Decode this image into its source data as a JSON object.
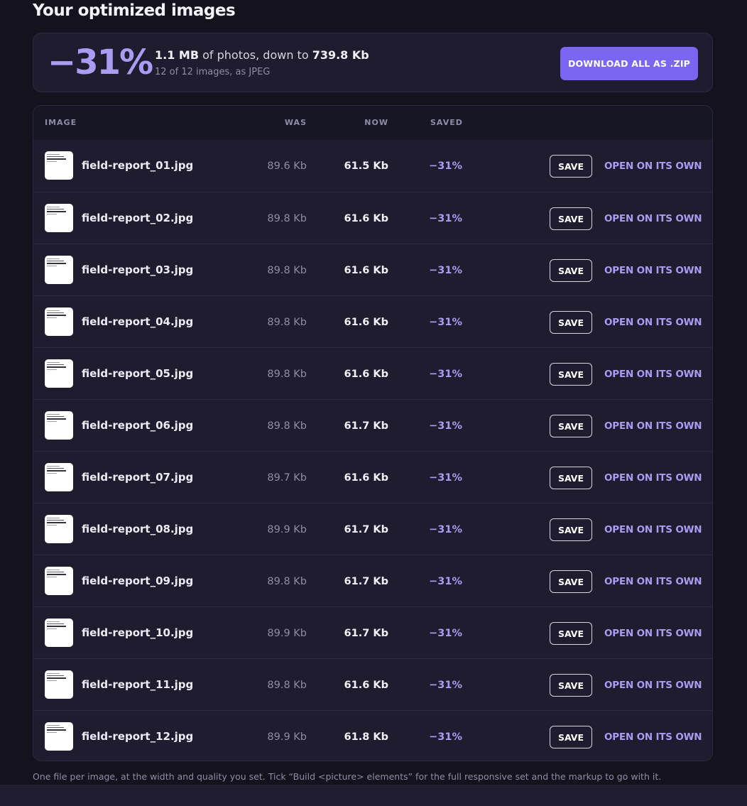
{
  "header": {
    "title": "Your optimized images"
  },
  "summary": {
    "percent": "−31%",
    "original_size": "1.1 MB",
    "text_mid": " of photos, down to ",
    "new_size": "739.8 Kb",
    "detail": "12 of 12 images, as JPEG",
    "download_label": "DOWNLOAD ALL AS .ZIP"
  },
  "table": {
    "headers": {
      "image": "IMAGE",
      "was": "WAS",
      "now": "NOW",
      "saved": "SAVED"
    },
    "save_label": "SAVE",
    "open_label": "OPEN ON ITS OWN",
    "rows": [
      {
        "name": "field-report_01.jpg",
        "was": "89.6 Kb",
        "now": "61.5 Kb",
        "saved": "−31%"
      },
      {
        "name": "field-report_02.jpg",
        "was": "89.8 Kb",
        "now": "61.6 Kb",
        "saved": "−31%"
      },
      {
        "name": "field-report_03.jpg",
        "was": "89.8 Kb",
        "now": "61.6 Kb",
        "saved": "−31%"
      },
      {
        "name": "field-report_04.jpg",
        "was": "89.8 Kb",
        "now": "61.6 Kb",
        "saved": "−31%"
      },
      {
        "name": "field-report_05.jpg",
        "was": "89.8 Kb",
        "now": "61.6 Kb",
        "saved": "−31%"
      },
      {
        "name": "field-report_06.jpg",
        "was": "89.8 Kb",
        "now": "61.7 Kb",
        "saved": "−31%"
      },
      {
        "name": "field-report_07.jpg",
        "was": "89.7 Kb",
        "now": "61.6 Kb",
        "saved": "−31%"
      },
      {
        "name": "field-report_08.jpg",
        "was": "89.9 Kb",
        "now": "61.7 Kb",
        "saved": "−31%"
      },
      {
        "name": "field-report_09.jpg",
        "was": "89.8 Kb",
        "now": "61.7 Kb",
        "saved": "−31%"
      },
      {
        "name": "field-report_10.jpg",
        "was": "89.9 Kb",
        "now": "61.7 Kb",
        "saved": "−31%"
      },
      {
        "name": "field-report_11.jpg",
        "was": "89.8 Kb",
        "now": "61.6 Kb",
        "saved": "−31%"
      },
      {
        "name": "field-report_12.jpg",
        "was": "89.9 Kb",
        "now": "61.8 Kb",
        "saved": "−31%"
      }
    ]
  },
  "footnote": "One file per image, at the width and quality you set. Tick “Build <picture> elements” for the full responsive set and the markup to go with it.",
  "colors": {
    "background": "#13121d",
    "panel": "#1e1c2e",
    "accent": "#7a66f0",
    "accent_text": "#a99cf2"
  },
  "icons": {
    "thumbnail": "document-thumbnail-image"
  }
}
